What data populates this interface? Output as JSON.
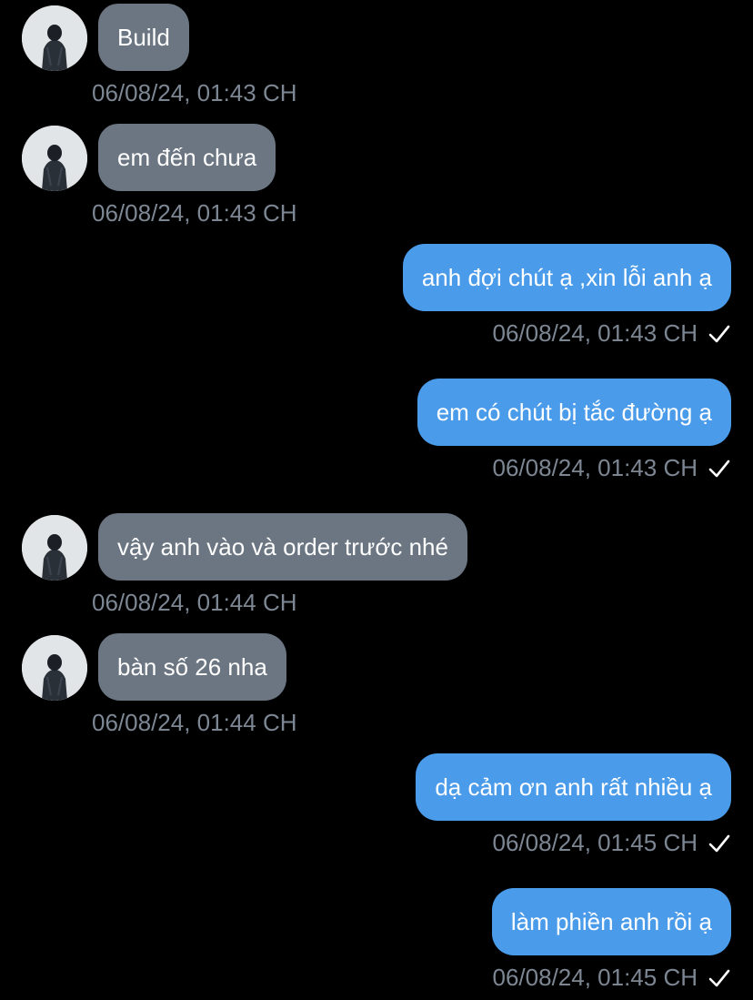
{
  "messages": [
    {
      "direction": "incoming",
      "text": "Build",
      "timestamp": "06/08/24, 01:43 CH"
    },
    {
      "direction": "incoming",
      "text": "em đến chưa",
      "timestamp": "06/08/24, 01:43 CH"
    },
    {
      "direction": "outgoing",
      "text": "anh đợi chút ạ ,xin lỗi anh ạ",
      "timestamp": "06/08/24, 01:43 CH",
      "status_icon": "checkmark-icon"
    },
    {
      "direction": "outgoing",
      "text": "em có chút bị tắc đường ạ",
      "timestamp": "06/08/24, 01:43 CH",
      "status_icon": "checkmark-icon"
    },
    {
      "direction": "incoming",
      "text": "vậy anh vào và order trước nhé",
      "timestamp": "06/08/24, 01:44 CH"
    },
    {
      "direction": "incoming",
      "text": "bàn số 26 nha",
      "timestamp": "06/08/24, 01:44 CH"
    },
    {
      "direction": "outgoing",
      "text": "dạ cảm ơn anh rất nhiều ạ",
      "timestamp": "06/08/24, 01:45 CH",
      "status_icon": "checkmark-icon"
    },
    {
      "direction": "outgoing",
      "text": "làm phiền anh rồi ạ",
      "timestamp": "06/08/24, 01:45 CH",
      "status_icon": "checkmark-icon"
    }
  ],
  "colors": {
    "background": "#000000",
    "incoming_bubble": "#6b7682",
    "outgoing_bubble": "#4a9bea",
    "timestamp": "#7d8794",
    "text": "#ffffff"
  }
}
